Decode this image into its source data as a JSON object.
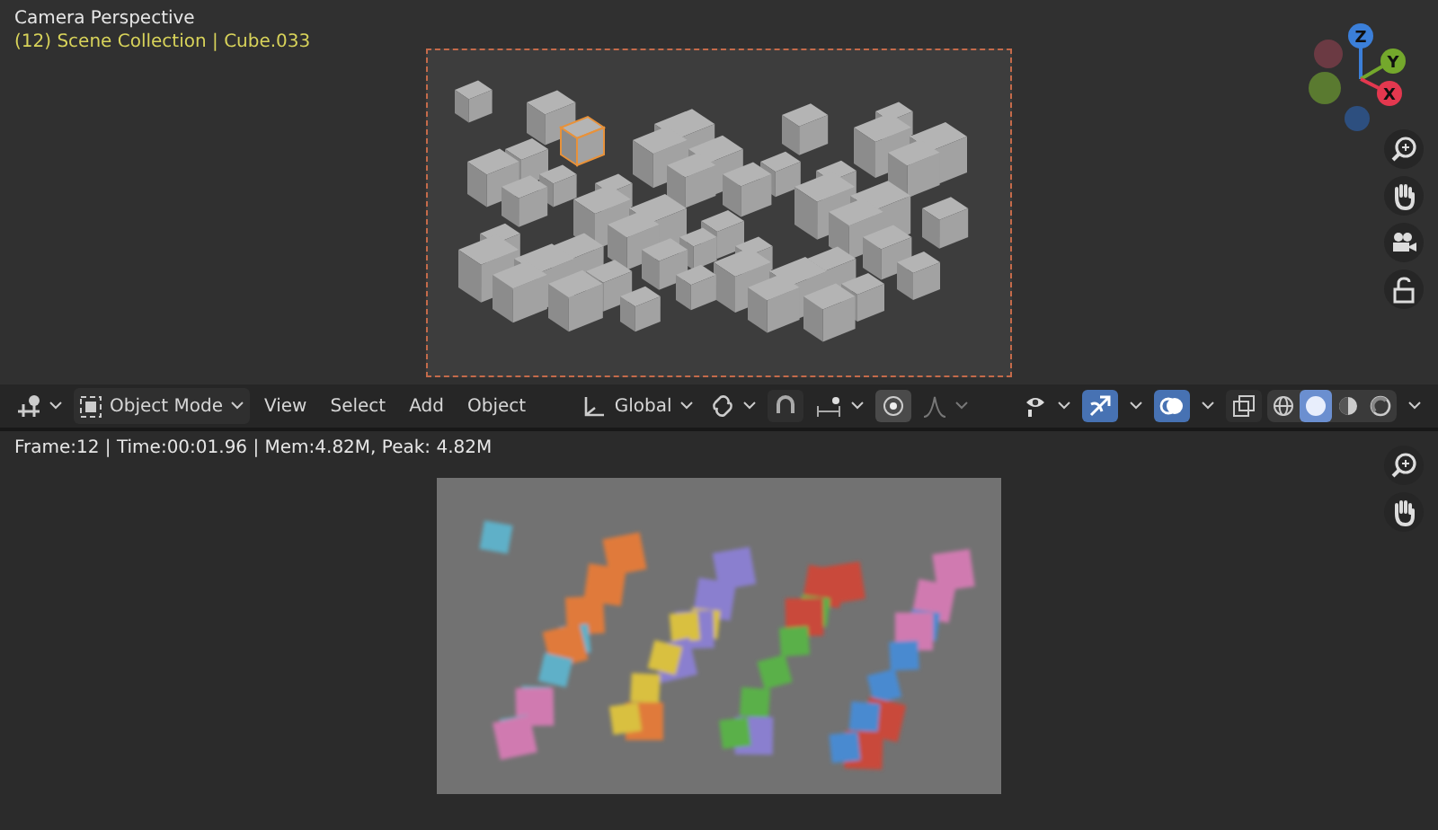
{
  "viewport": {
    "title": "Camera Perspective",
    "subtitle": "(12) Scene Collection | Cube.033",
    "gizmo": [
      {
        "label": "Z",
        "color": "#3b7fd9"
      },
      {
        "label": "Y",
        "color": "#74a82c"
      },
      {
        "label": "X",
        "color": "#e3384f"
      }
    ]
  },
  "header": {
    "mode": "Object Mode",
    "menus": [
      "View",
      "Select",
      "Add",
      "Object"
    ],
    "orientation": "Global",
    "proportional_on": true,
    "gizmos_on": true,
    "overlays_on": true,
    "xray_on": false,
    "shading": [
      {
        "kind": "wireframe",
        "selected": false
      },
      {
        "kind": "solid",
        "selected": true
      },
      {
        "kind": "material",
        "selected": false
      },
      {
        "kind": "rendered",
        "selected": false
      }
    ]
  },
  "render": {
    "status": "Frame:12 | Time:00:01.96 | Mem:4.82M, Peak: 4.82M"
  }
}
